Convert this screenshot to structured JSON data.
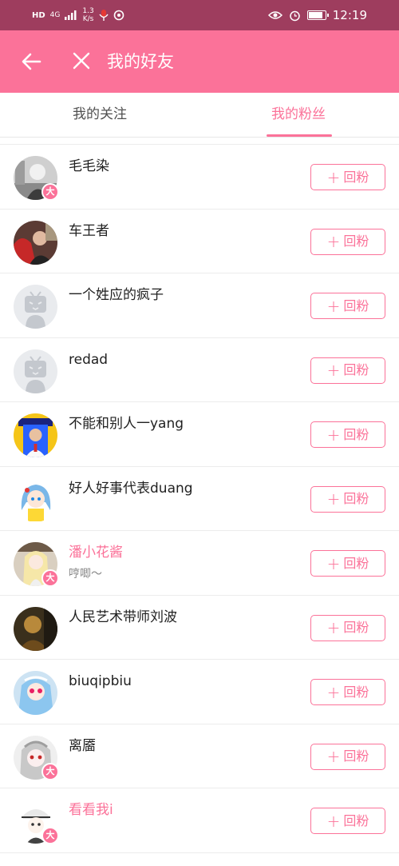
{
  "status_bar": {
    "hd": "HD",
    "network": "4G",
    "speed_value": "1.3",
    "speed_unit": "K/s",
    "time": "12:19",
    "battery_level": 0.9,
    "icons": [
      "signal-icon",
      "mic-icon",
      "sync-icon",
      "eye-icon",
      "alarm-icon",
      "battery-icon"
    ]
  },
  "appbar": {
    "back_icon": "arrow-left-icon",
    "close_icon": "close-icon",
    "title": "我的好友"
  },
  "tabs": [
    {
      "label": "我的关注",
      "active": false
    },
    {
      "label": "我的粉丝",
      "active": true
    }
  ],
  "colors": {
    "accent": "#fb7299",
    "status_bar": "#9e3d5e",
    "text": "#212121",
    "secondary_text": "#888888"
  },
  "follow_back_label": "回粉",
  "badge_text": "大",
  "fans": [
    {
      "name": "毛毛染",
      "vip": false,
      "badge": true,
      "sign": "",
      "avatar": "bw-photo"
    },
    {
      "name": "车王者",
      "vip": false,
      "badge": false,
      "sign": "",
      "avatar": "red-photo"
    },
    {
      "name": "一个姓应的疯子",
      "vip": false,
      "badge": false,
      "sign": "",
      "avatar": "default-tv"
    },
    {
      "name": "redad",
      "vip": false,
      "badge": false,
      "sign": "",
      "avatar": "default-tv"
    },
    {
      "name": "不能和别人一yang",
      "vip": false,
      "badge": false,
      "sign": "",
      "avatar": "yellow-photo"
    },
    {
      "name": "好人好事代表duang",
      "vip": false,
      "badge": false,
      "sign": "",
      "avatar": "anime-blue"
    },
    {
      "name": "潘小花酱",
      "vip": true,
      "badge": true,
      "sign": "哼唧～",
      "avatar": "anime-blonde"
    },
    {
      "name": "人民艺术带师刘波",
      "vip": false,
      "badge": false,
      "sign": "",
      "avatar": "dark-photo"
    },
    {
      "name": "biuqipbiu",
      "vip": false,
      "badge": false,
      "sign": "",
      "avatar": "anime-pink"
    },
    {
      "name": "离靥",
      "vip": false,
      "badge": true,
      "sign": "",
      "avatar": "anime-grey"
    },
    {
      "name": "看看我i",
      "vip": true,
      "badge": true,
      "sign": "",
      "avatar": "anime-white"
    }
  ]
}
